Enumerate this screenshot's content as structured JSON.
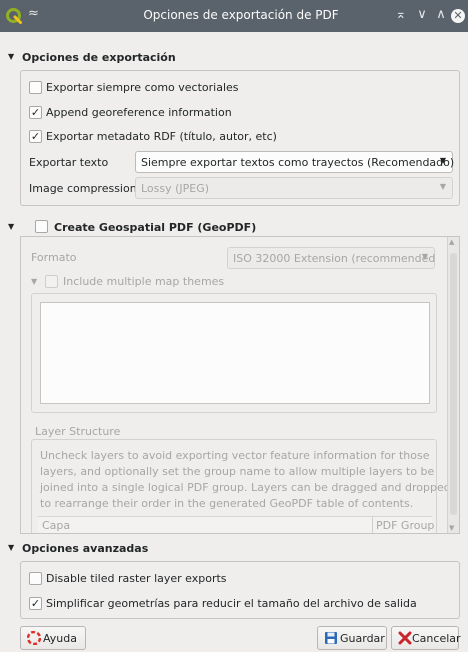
{
  "window": {
    "title": "Opciones de exportación de PDF",
    "keep_above_glyph": "≈",
    "min_glyph": "⌅",
    "shade_glyph": "∨",
    "max_glyph": "∧",
    "close_glyph": "✕"
  },
  "export_options": {
    "header": "Opciones de exportación",
    "always_vector": {
      "label": "Exportar siempre como vectoriales",
      "checked": false
    },
    "append_georef": {
      "label": "Append georeference information",
      "checked": true
    },
    "export_rdf": {
      "label": "Exportar metadato RDF (título, autor, etc)",
      "checked": true
    },
    "text_export": {
      "label": "Exportar texto",
      "value": "Siempre exportar textos como trayectos (Recomendado)"
    },
    "image_compression": {
      "label": "Image compression",
      "value": "Lossy (JPEG)"
    }
  },
  "geopdf": {
    "header": "Create Geospatial PDF (GeoPDF)",
    "checked": false,
    "format_label": "Formato",
    "format_value": "ISO 32000 Extension (recommended",
    "map_themes": {
      "label": "Include multiple map themes",
      "checked": false
    },
    "layer_structure_label": "Layer Structure",
    "layer_structure_desc": [
      "Uncheck layers to avoid exporting vector feature information for those",
      "layers, and optionally set the group name to allow multiple layers to be",
      "joined into a single logical PDF group. Layers can be dragged and dropped",
      "to rearrange their order in the generated GeoPDF table of contents."
    ],
    "col_layer": "Capa",
    "col_group": "PDF Group"
  },
  "advanced": {
    "header": "Opciones avanzadas",
    "disable_tiled": {
      "label": "Disable tiled raster layer exports",
      "checked": false
    },
    "simplify": {
      "label": "Simplificar geometrías para reducir el tamaño del archivo de salida",
      "checked": true
    }
  },
  "buttons": {
    "help": "Ayuda",
    "save": "Guardar",
    "cancel": "Cancelar"
  },
  "colors": {
    "titlebar": "#5a636b",
    "window_bg": "#efeeed",
    "help_icon": "#e0302b",
    "save_icon": "#2a6ab8",
    "cancel_icon": "#c8262b",
    "qgis_green": "#93b023"
  }
}
